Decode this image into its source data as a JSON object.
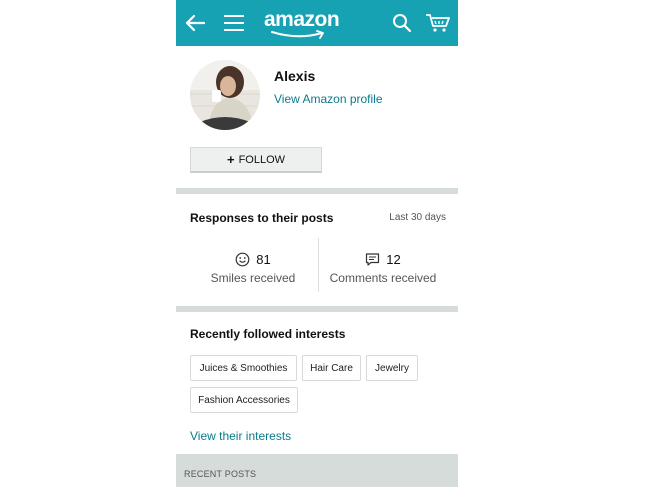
{
  "topbar": {
    "background": "#17a2b3",
    "logo_text": "amazon",
    "icons": [
      "back-arrow-icon",
      "hamburger-menu-icon",
      "search-icon",
      "cart-icon"
    ]
  },
  "profile": {
    "name": "Alexis",
    "link_label": "View Amazon profile",
    "follow_label": "FOLLOW",
    "follow_icon": "+"
  },
  "responses": {
    "title": "Responses to their posts",
    "period": "Last 30 days",
    "smiles": {
      "count": "81",
      "label": "Smiles received",
      "icon": "smile-icon"
    },
    "comments": {
      "count": "12",
      "label": "Comments received",
      "icon": "comment-icon"
    }
  },
  "interests": {
    "title": "Recently followed interests",
    "chips": [
      "Juices & Smoothies",
      "Hair Care",
      "Jewelry",
      "Fashion Accessories"
    ],
    "link_label": "View their interests"
  },
  "recent_posts": {
    "label": "RECENT POSTS"
  },
  "colors": {
    "accent": "#17a2b3",
    "link": "#0a7b8e",
    "section_divider": "#d6dcda"
  }
}
